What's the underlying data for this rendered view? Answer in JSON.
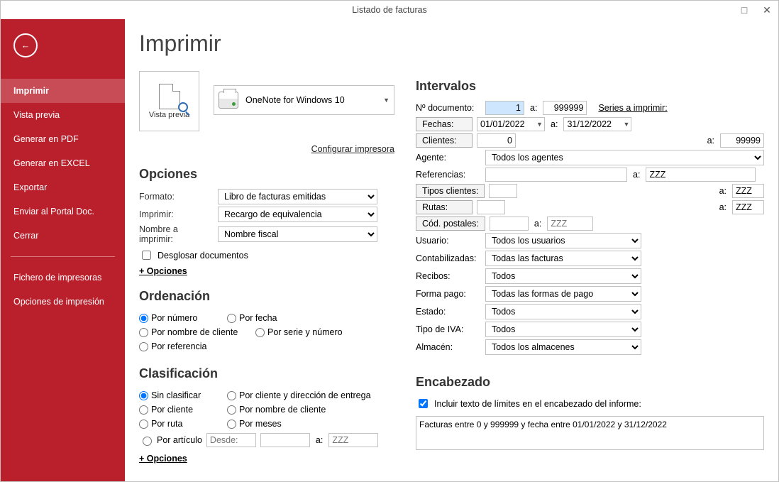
{
  "window": {
    "title": "Listado de facturas"
  },
  "sidebar": {
    "items": [
      "Imprimir",
      "Vista previa",
      "Generar en PDF",
      "Generar en EXCEL",
      "Exportar",
      "Enviar al Portal Doc.",
      "Cerrar"
    ],
    "items2": [
      "Fichero de impresoras",
      "Opciones de impresión"
    ]
  },
  "header": {
    "title": "Imprimir"
  },
  "preview": {
    "card_label": "Vista previa",
    "printer": "OneNote for Windows 10",
    "configure_link": "Configurar impresora"
  },
  "options": {
    "heading": "Opciones",
    "rows": {
      "formato_label": "Formato:",
      "formato_value": "Libro de facturas emitidas",
      "imprimir_label": "Imprimir:",
      "imprimir_value": "Recargo de equivalencia",
      "nombre_label": "Nombre a imprimir:",
      "nombre_value": "Nombre fiscal"
    },
    "desglosar": "Desglosar documentos",
    "plus": "+ Opciones"
  },
  "ordenacion": {
    "heading": "Ordenación",
    "opts": [
      "Por número",
      "Por fecha",
      "Por nombre de cliente",
      "Por serie y número",
      "Por referencia"
    ]
  },
  "clasificacion": {
    "heading": "Clasificación",
    "opts": [
      "Sin clasificar",
      "Por cliente y dirección de entrega",
      "Por cliente",
      "Por nombre de cliente",
      "Por ruta",
      "Por meses",
      "Por artículo"
    ],
    "desde": "Desde:",
    "a": "a:",
    "zzz": "ZZZ",
    "plus": "+ Opciones"
  },
  "intervalos": {
    "heading": "Intervalos",
    "ndoc_label": "Nº documento:",
    "ndoc_from": "1",
    "ndoc_to": "999999",
    "a": "a:",
    "series_link": "Series a imprimir:",
    "fechas_btn": "Fechas:",
    "fecha_from": "01/01/2022",
    "fecha_to": "31/12/2022",
    "clientes_btn": "Clientes:",
    "cli_from": "0",
    "cli_to": "99999",
    "agente_label": "Agente:",
    "agente_value": "Todos los agentes",
    "ref_label": "Referencias:",
    "zzz": "ZZZ",
    "tipos_btn": "Tipos clientes:",
    "rutas_btn": "Rutas:",
    "cpost_btn": "Cód. postales:",
    "usuario_label": "Usuario:",
    "usuario_value": "Todos los usuarios",
    "contab_label": "Contabilizadas:",
    "contab_value": "Todas las facturas",
    "recibos_label": "Recibos:",
    "recibos_value": "Todos",
    "fpago_label": "Forma pago:",
    "fpago_value": "Todas las formas de pago",
    "estado_label": "Estado:",
    "estado_value": "Todos",
    "tipoiva_label": "Tipo de IVA:",
    "tipoiva_value": "Todos",
    "almacen_label": "Almacén:",
    "almacen_value": "Todos los almacenes"
  },
  "encabezado": {
    "heading": "Encabezado",
    "check_label": "Incluir texto de límites en el encabezado del informe:",
    "text": "Facturas entre 0 y 999999 y fecha entre 01/01/2022 y 31/12/2022"
  }
}
